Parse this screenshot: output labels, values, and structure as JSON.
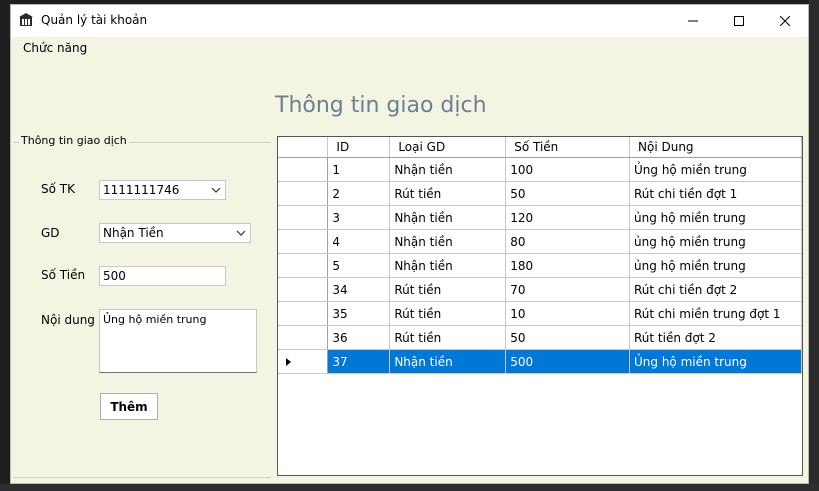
{
  "window": {
    "title": "Quản lý tài khoản"
  },
  "menu": {
    "items": [
      {
        "label": "Chức năng"
      }
    ]
  },
  "heading": "Thông tin giao dịch",
  "form": {
    "group_title": "Thông tin giao dịch",
    "account_label": "Số TK",
    "account_value": "1111111746",
    "type_label": "GD",
    "type_value": "Nhận Tiền",
    "amount_label": "Số Tiền",
    "amount_value": "500",
    "content_label": "Nội dung",
    "content_value": "Ủng hộ miền trung",
    "add_button": "Thêm"
  },
  "grid": {
    "columns": [
      "ID",
      "Loại GD",
      "Số Tiền",
      "Nội Dung"
    ],
    "rows": [
      {
        "id": "1",
        "type": "Nhận tiền",
        "amount": "100",
        "content": "Ủng hộ miền trung"
      },
      {
        "id": "2",
        "type": "Rút tiền",
        "amount": "50",
        "content": "Rút chi tiền đợt 1"
      },
      {
        "id": "3",
        "type": "Nhận tiền",
        "amount": "120",
        "content": "ủng hộ miền trung"
      },
      {
        "id": "4",
        "type": "Nhận tiền",
        "amount": "80",
        "content": "ủng hộ miền trung"
      },
      {
        "id": "5",
        "type": "Nhận tiền",
        "amount": "180",
        "content": "ủng hộ miền trung"
      },
      {
        "id": "34",
        "type": "Rút tiền",
        "amount": "70",
        "content": "Rút chi tiền đợt 2"
      },
      {
        "id": "35",
        "type": "Rút tiền",
        "amount": "10",
        "content": "Rút chi miền trung đợt 1"
      },
      {
        "id": "36",
        "type": "Rút tiền",
        "amount": "50",
        "content": "Rút tiền đợt 2"
      },
      {
        "id": "37",
        "type": "Nhận tiền",
        "amount": "500",
        "content": "Ủng hộ miền trung"
      }
    ],
    "selected_index": 8
  },
  "colors": {
    "accent": "#0078d7",
    "heading": "#6d7f93",
    "window_bg": "#f4f4e3"
  }
}
